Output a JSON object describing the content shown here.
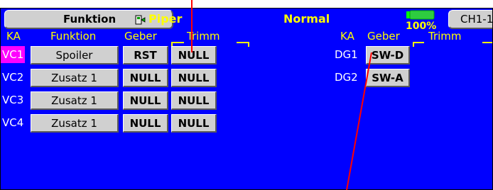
{
  "header": {
    "function_button": "Funktion",
    "model_name": "Piper",
    "mode": "Normal",
    "battery_percent": "100%",
    "battery_level": 1.0,
    "channel_button": "CH1-12"
  },
  "left_table": {
    "col_ka": "KA",
    "col_funktion": "Funktion",
    "col_geber": "Geber",
    "col_trimm": "Trimm",
    "rows": [
      {
        "ka": "VC1",
        "funktion": "Spoiler",
        "geber": "RST",
        "trimm": "NULL"
      },
      {
        "ka": "VC2",
        "funktion": "Zusatz 1",
        "geber": "NULL",
        "trimm": "NULL"
      },
      {
        "ka": "VC3",
        "funktion": "Zusatz 1",
        "geber": "NULL",
        "trimm": "NULL"
      },
      {
        "ka": "VC4",
        "funktion": "Zusatz 1",
        "geber": "NULL",
        "trimm": "NULL"
      }
    ]
  },
  "right_table": {
    "col_ka": "KA",
    "col_geber": "Geber",
    "col_trimm": "Trimm",
    "rows": [
      {
        "ka": "DG1",
        "geber": "SW-D"
      },
      {
        "ka": "DG2",
        "geber": "SW-A"
      }
    ]
  },
  "colors": {
    "screen_bg": "#0000ff",
    "header_text": "#ffff00",
    "selected_row_bg": "#ff00ff",
    "pointer_line": "#ff0000"
  }
}
